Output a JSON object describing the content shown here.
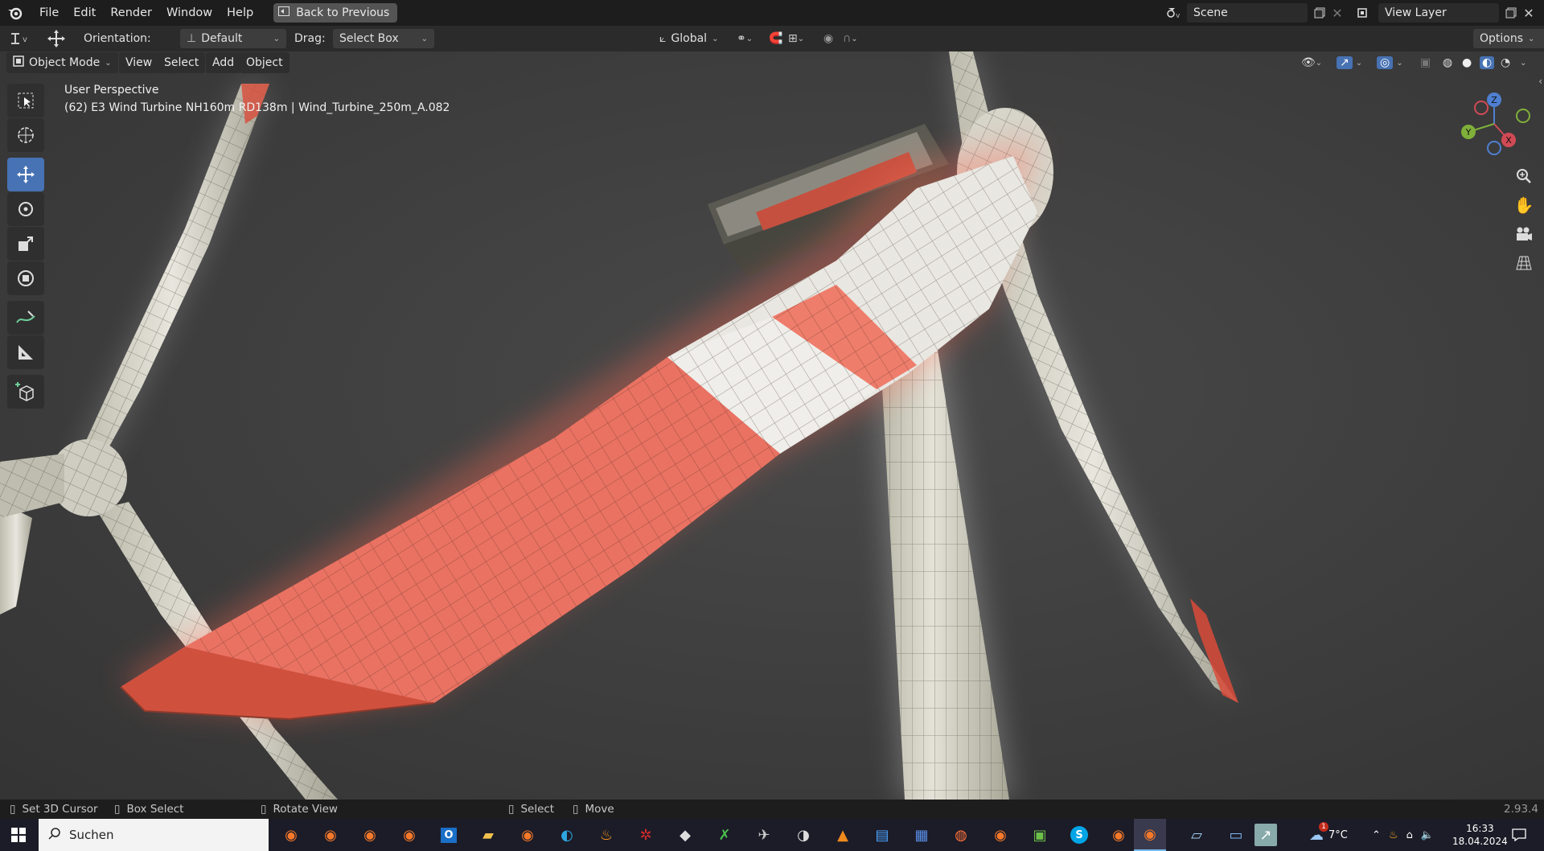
{
  "topbar": {
    "menu": [
      "File",
      "Edit",
      "Render",
      "Window",
      "Help"
    ],
    "back_button": "Back to Previous",
    "scene_field": "Scene",
    "view_layer_field": "View Layer"
  },
  "toolbar": {
    "orientation_label": "Orientation:",
    "orientation_value": "Default",
    "drag_label": "Drag:",
    "drag_value": "Select Box",
    "transform_space": "Global",
    "options_label": "Options"
  },
  "viewport_header": {
    "mode": "Object Mode",
    "menus": [
      "View",
      "Select",
      "Add",
      "Object"
    ]
  },
  "viewport": {
    "perspective": "User Perspective",
    "object_info": "(62) E3 Wind Turbine NH160m RD138m | Wind_Turbine_250m_A.082",
    "gizmo_axes": {
      "z": "Z",
      "y": "Y",
      "x": "X"
    }
  },
  "statusbar": {
    "hint1": "Set 3D Cursor",
    "hint2": "Box Select",
    "hint3": "Rotate View",
    "hint4": "Select",
    "hint5": "Move",
    "version": "2.93.4"
  },
  "taskbar": {
    "search_placeholder": "Suchen",
    "weather": "7°C",
    "time": "16:33",
    "date": "18.04.2024",
    "weather_badge": "1"
  },
  "colors": {
    "accent": "#4772b3",
    "blade_red": "#e2604a",
    "blade_white": "#dcd9d2"
  }
}
